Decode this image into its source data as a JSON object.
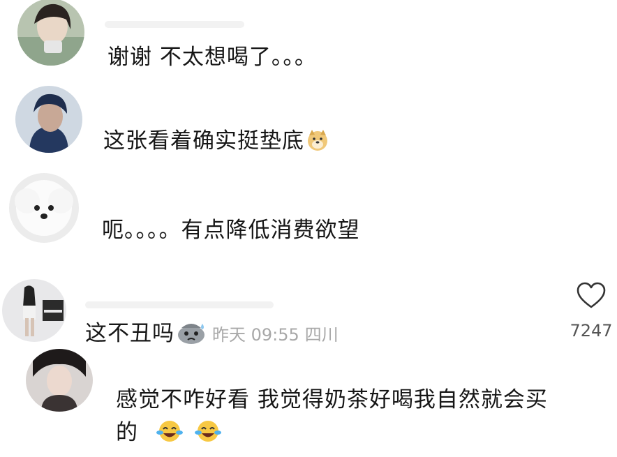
{
  "comments": [
    {
      "text": "谢谢 不太想喝了。。。",
      "emoji": []
    },
    {
      "text": "这张看着确实挺垫底",
      "emoji": [
        "doge"
      ]
    },
    {
      "text": "呃。。。。有点降低消费欲望",
      "emoji": []
    },
    {
      "text": "这不丑吗",
      "emoji": [
        "sweat"
      ],
      "time": "昨天 09:55",
      "location": "四川",
      "likes": "7247"
    },
    {
      "text_line1": "感觉不咋好看 我觉得奶茶好喝我自然就会买",
      "text_line2": "的",
      "emoji": [
        "crying-laughing",
        "crying-laughing"
      ]
    }
  ],
  "icons": {
    "like": "heart-outline-icon"
  }
}
